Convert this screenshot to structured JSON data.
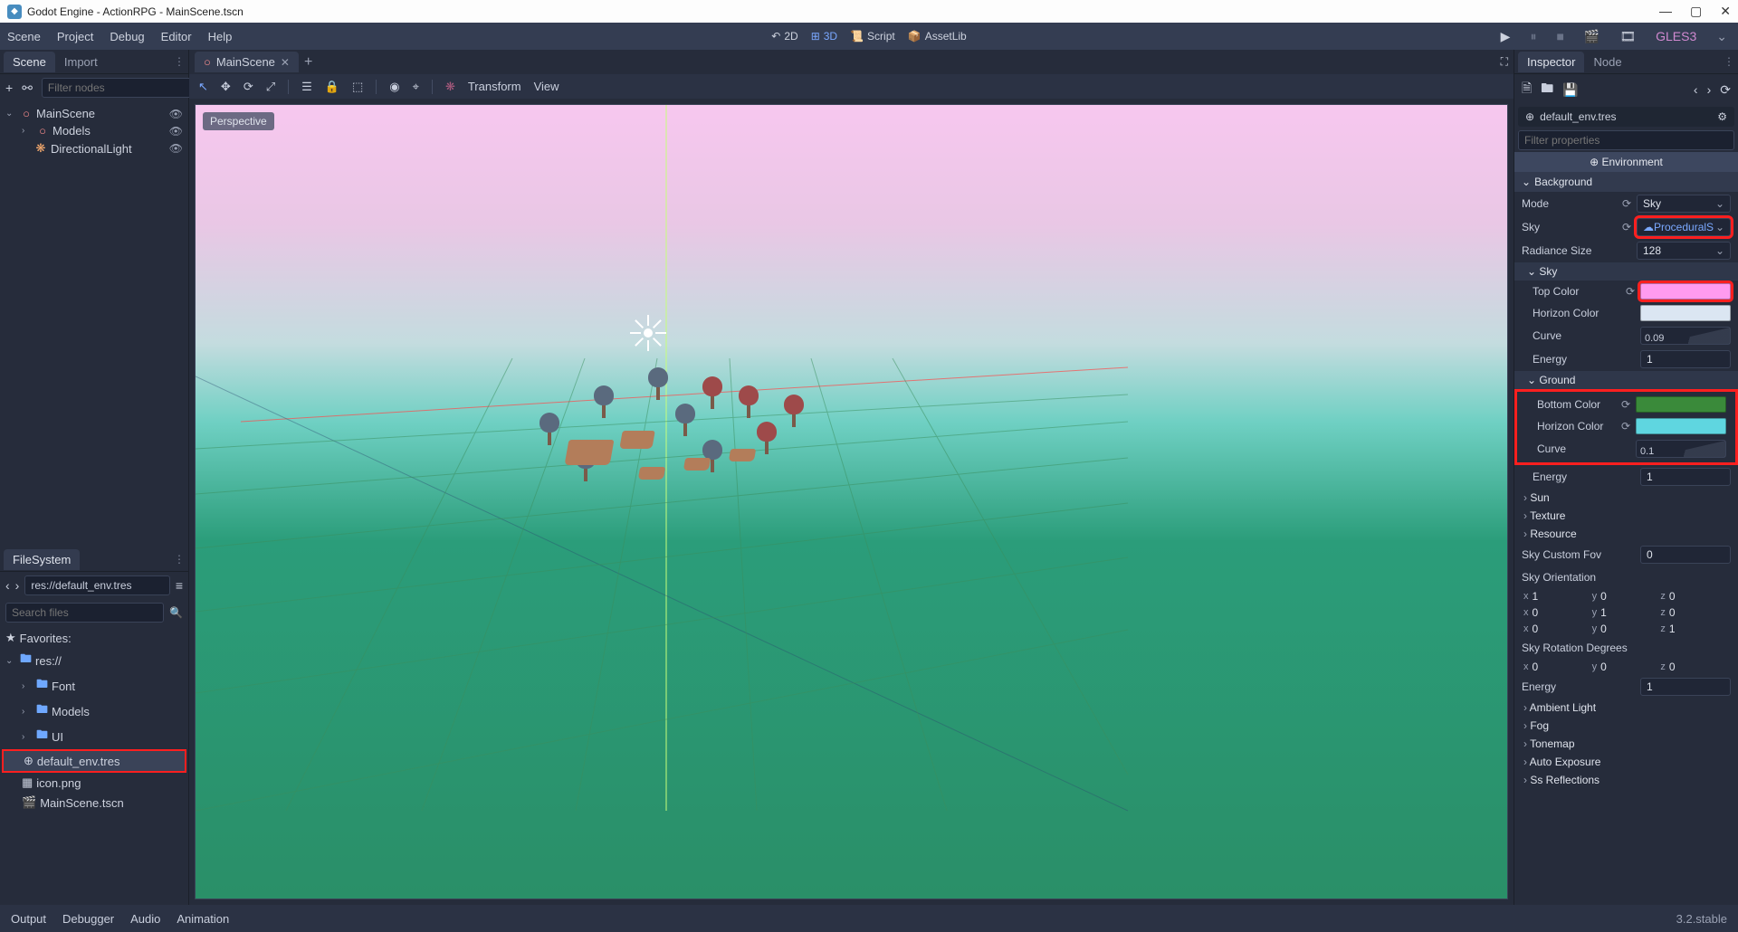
{
  "window": {
    "title": "Godot Engine - ActionRPG - MainScene.tscn"
  },
  "menubar": {
    "items": [
      "Scene",
      "Project",
      "Debug",
      "Editor",
      "Help"
    ],
    "modes": {
      "d2": "2D",
      "d3": "3D",
      "script": "Script",
      "assetlib": "AssetLib"
    },
    "renderer": "GLES3"
  },
  "scene_dock": {
    "tabs": {
      "scene": "Scene",
      "import": "Import"
    },
    "filter_placeholder": "Filter nodes",
    "nodes": {
      "root": "MainScene",
      "models": "Models",
      "light": "DirectionalLight"
    }
  },
  "filesystem": {
    "title": "FileSystem",
    "path": "res://default_env.tres",
    "search_placeholder": "Search files",
    "favorites": "Favorites:",
    "root": "res://",
    "folders": [
      "Font",
      "Models",
      "UI"
    ],
    "files": {
      "env": "default_env.tres",
      "icon": "icon.png",
      "scene": "MainScene.tscn"
    }
  },
  "center": {
    "tab": "MainScene",
    "perspective": "Perspective",
    "transform": "Transform",
    "view": "View"
  },
  "bottom": {
    "output": "Output",
    "debugger": "Debugger",
    "audio": "Audio",
    "animation": "Animation",
    "version": "3.2.stable"
  },
  "inspector": {
    "tabs": {
      "inspector": "Inspector",
      "node": "Node"
    },
    "resource": "default_env.tres",
    "filter_placeholder": "Filter properties",
    "category": "Environment",
    "sections": {
      "background": "Background",
      "sky": "Sky",
      "ground": "Ground",
      "sun": "Sun",
      "texture": "Texture",
      "resource": "Resource",
      "ambient": "Ambient Light",
      "fog": "Fog",
      "tonemap": "Tonemap",
      "autoexp": "Auto Exposure",
      "ssrefl": "Ss Reflections"
    },
    "props": {
      "mode": {
        "label": "Mode",
        "value": "Sky"
      },
      "sky": {
        "label": "Sky",
        "value": "ProceduralS"
      },
      "radiance": {
        "label": "Radiance Size",
        "value": "128"
      },
      "top_color": {
        "label": "Top Color",
        "color": "#ff9bef"
      },
      "sky_horizon": {
        "label": "Horizon Color",
        "color": "#dbe6f2"
      },
      "sky_curve": {
        "label": "Curve",
        "value": "0.09"
      },
      "sky_energy": {
        "label": "Energy",
        "value": "1"
      },
      "bottom_color": {
        "label": "Bottom Color",
        "color": "#3a8a3a"
      },
      "ground_horizon": {
        "label": "Horizon Color",
        "color": "#5fd6e0"
      },
      "ground_curve": {
        "label": "Curve",
        "value": "0.1"
      },
      "ground_energy": {
        "label": "Energy",
        "value": "1"
      },
      "sky_fov": {
        "label": "Sky Custom Fov",
        "value": "0"
      },
      "sky_orient": "Sky Orientation",
      "sky_rot": "Sky Rotation Degrees",
      "energy": {
        "label": "Energy",
        "value": "1"
      },
      "orientation_matrix": [
        {
          "x": "1",
          "y": "0",
          "z": "0"
        },
        {
          "x": "0",
          "y": "1",
          "z": "0"
        },
        {
          "x": "0",
          "y": "0",
          "z": "1"
        }
      ],
      "rotation_degrees": {
        "x": "0",
        "y": "0",
        "z": "0"
      }
    }
  }
}
